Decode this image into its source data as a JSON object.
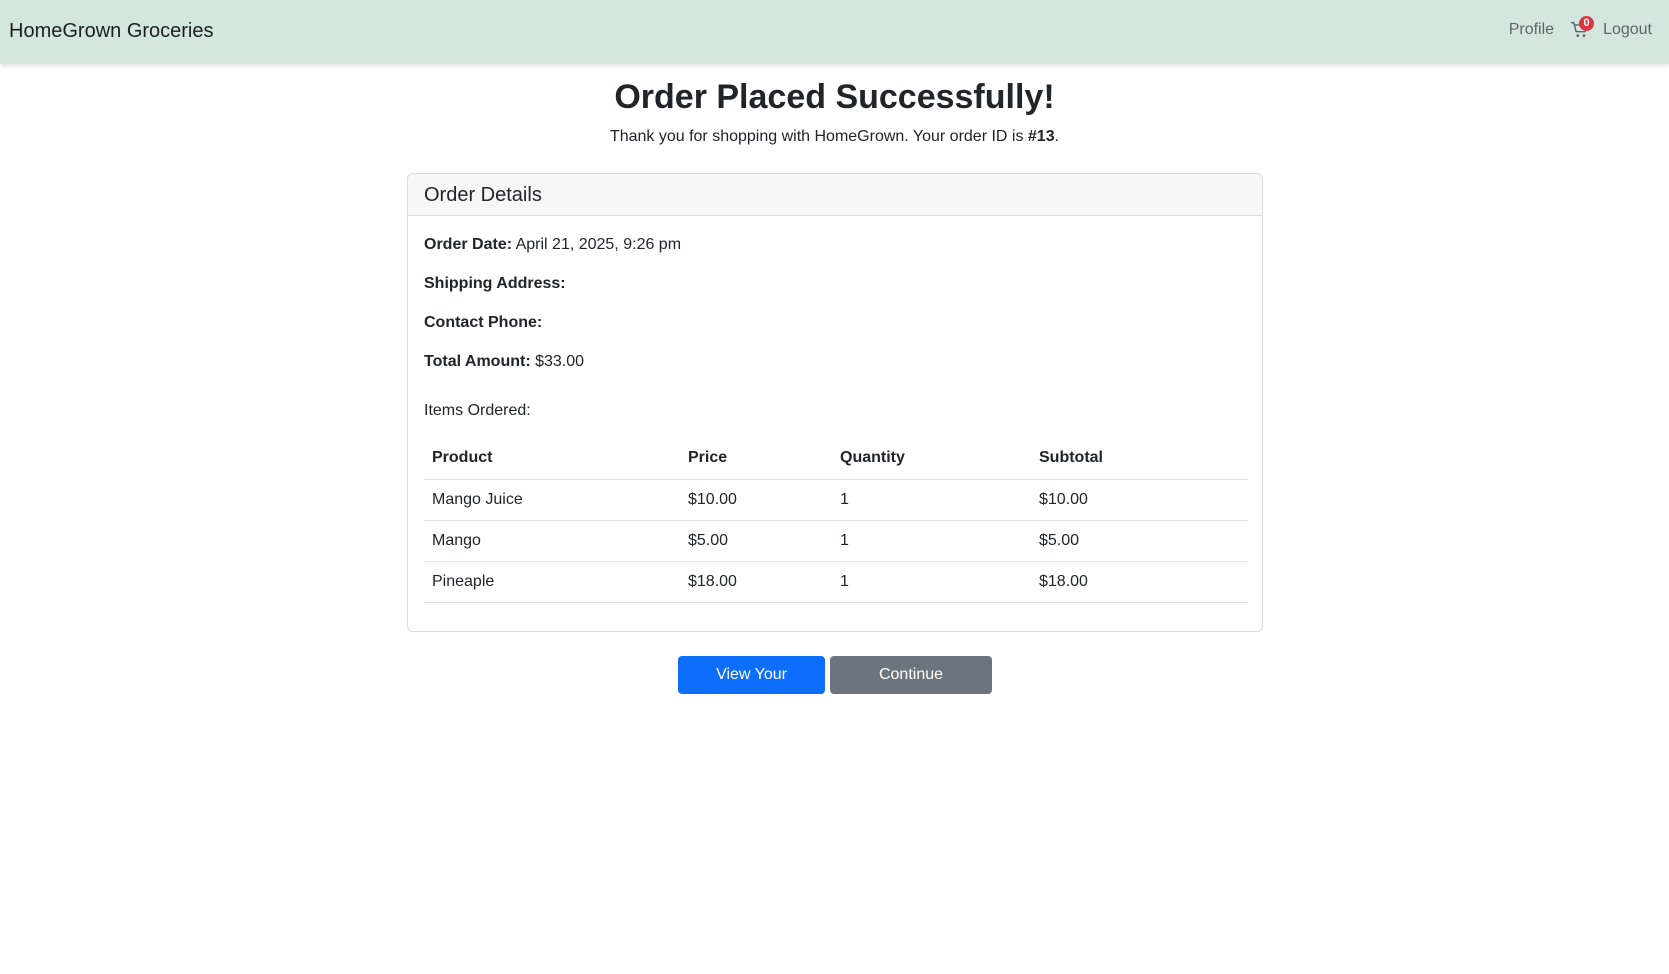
{
  "navbar": {
    "brand": "HomeGrown Groceries",
    "profile_label": "Profile",
    "cart_count": "0",
    "logout_label": "Logout"
  },
  "confirmation": {
    "title": "Order Placed Successfully!",
    "thanks_prefix": "Thank you for shopping with HomeGrown. Your order ID is ",
    "order_id": "#13",
    "thanks_suffix": "."
  },
  "details": {
    "header": "Order Details",
    "order_date_label": "Order Date:",
    "order_date_value": "April 21, 2025, 9:26 pm",
    "shipping_label": "Shipping Address:",
    "shipping_value": "",
    "phone_label": "Contact Phone:",
    "phone_value": "",
    "total_label": "Total Amount:",
    "total_value": "$33.00",
    "items_label": "Items Ordered:"
  },
  "items_table": {
    "columns": [
      "Product",
      "Price",
      "Quantity",
      "Subtotal"
    ],
    "rows": [
      [
        "Mango Juice",
        "$10.00",
        "1",
        "$10.00"
      ],
      [
        "Mango",
        "$5.00",
        "1",
        "$5.00"
      ],
      [
        "Pineaple",
        "$18.00",
        "1",
        "$18.00"
      ]
    ]
  },
  "actions": {
    "view_orders_label": "View Your Orders",
    "continue_label": "Continue Shopping"
  },
  "colors": {
    "navbar_bg": "#d3e7de",
    "primary": "#0d6efd",
    "secondary": "#6c757d",
    "badge": "#dc3545"
  }
}
